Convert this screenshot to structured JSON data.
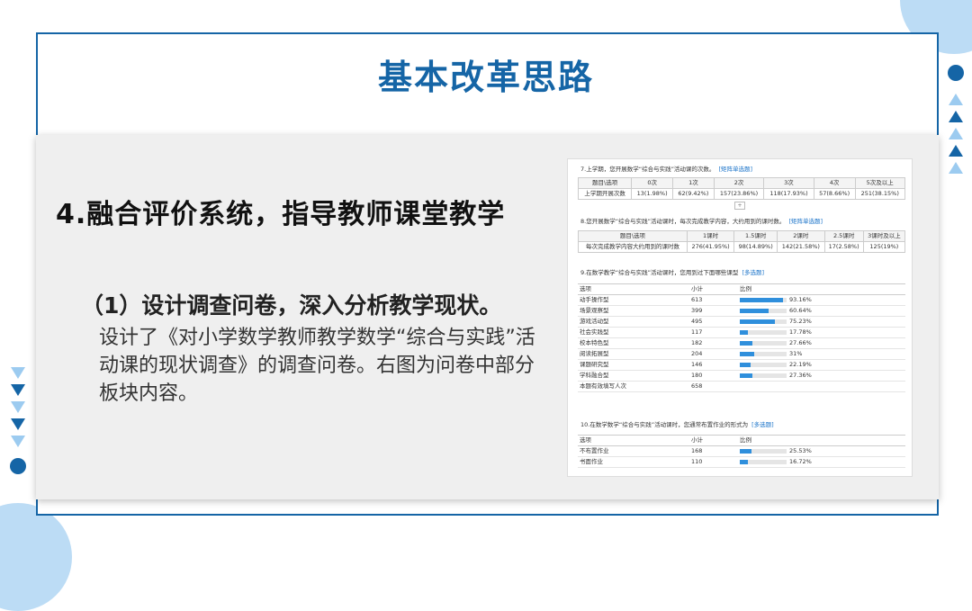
{
  "title": "基本改革思路",
  "heading": "4.融合评价系统，指导教师课堂教学",
  "subheading": "（1）设计调查问卷，深入分析教学现状。",
  "body_text": "设计了《对小学数学教师教学数学“综合与实践”活动课的现状调查》的调查问卷。右图为问卷中部分板块内容。",
  "survey": {
    "q7": {
      "title": "7.上学期，您开展数学“综合与实践”活动课的次数。",
      "tag": "[矩阵单选题]",
      "headers": [
        "题目\\选项",
        "0次",
        "1次",
        "2次",
        "3次",
        "4次",
        "5次及以上"
      ],
      "row_label": "上学期开展次数",
      "cells": [
        "13(1.98%)",
        "62(9.42%)",
        "157(23.86%)",
        "118(17.93%)",
        "57(8.66%)",
        "251(38.15%)"
      ]
    },
    "q8": {
      "title": "8.您开展数学“综合与实践”活动课时，每次完成教学内容，大约用到的课时数。",
      "tag": "[矩阵单选题]",
      "headers": [
        "题目\\选项",
        "1课时",
        "1.5课时",
        "2课时",
        "2.5课时",
        "3课时及以上"
      ],
      "row_label": "每次完成教学内容大约用到的课时数",
      "cells": [
        "276(41.95%)",
        "98(14.89%)",
        "142(21.58%)",
        "17(2.58%)",
        "125(19%)"
      ]
    },
    "q9": {
      "title": "9.在数学教学“综合与实践”活动课时，您用到过下面哪些课型",
      "tag": "[多选题]",
      "col_option": "选项",
      "col_count": "小计",
      "col_ratio": "比例",
      "rows": [
        {
          "label": "动手操作型",
          "count": "613",
          "pct": "93.16%",
          "ratio": 0.9316
        },
        {
          "label": "场景观察型",
          "count": "399",
          "pct": "60.64%",
          "ratio": 0.6064
        },
        {
          "label": "游戏活动型",
          "count": "495",
          "pct": "75.23%",
          "ratio": 0.7523
        },
        {
          "label": "社会实践型",
          "count": "117",
          "pct": "17.78%",
          "ratio": 0.1778
        },
        {
          "label": "校本特色型",
          "count": "182",
          "pct": "27.66%",
          "ratio": 0.2766
        },
        {
          "label": "阅读拓展型",
          "count": "204",
          "pct": "31%",
          "ratio": 0.31
        },
        {
          "label": "课题研究型",
          "count": "146",
          "pct": "22.19%",
          "ratio": 0.2219
        },
        {
          "label": "学科融合型",
          "count": "180",
          "pct": "27.36%",
          "ratio": 0.2736
        }
      ],
      "total_label": "本题有效填写人次",
      "total_value": "658"
    },
    "q10": {
      "title": "10.在数学数学“综合与实践”活动课时，您通常布置作业的形式为",
      "tag": "[多选题]",
      "col_option": "选项",
      "col_count": "小计",
      "col_ratio": "比例",
      "rows": [
        {
          "label": "不布置作业",
          "count": "168",
          "pct": "25.53%",
          "ratio": 0.2553
        },
        {
          "label": "书面作业",
          "count": "110",
          "pct": "16.72%",
          "ratio": 0.1672
        }
      ]
    },
    "plus_symbol": "+"
  },
  "colors": {
    "accent": "#1565a6",
    "accent_light": "#9ccbf0",
    "bar": "#2f8fdc"
  }
}
